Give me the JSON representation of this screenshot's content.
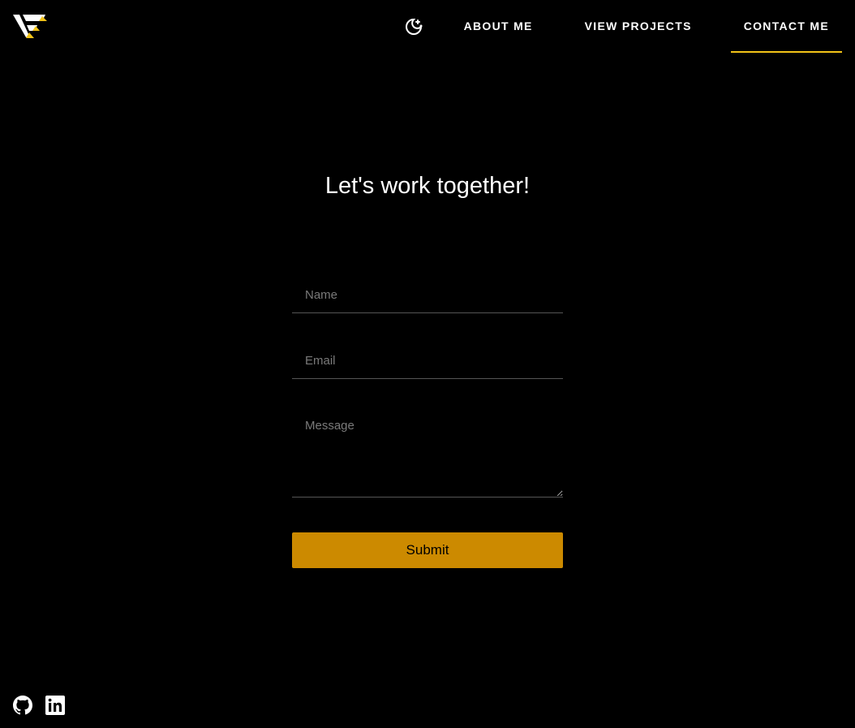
{
  "header": {
    "logo_icon": "vf-logo",
    "theme_toggle_icon": "moon-stars-icon",
    "nav": [
      {
        "label": "ABOUT ME",
        "active": false
      },
      {
        "label": "VIEW PROJECTS",
        "active": false
      },
      {
        "label": "CONTACT ME",
        "active": true
      }
    ],
    "accent_color": "#f2c318"
  },
  "main": {
    "title": "Let's work together!",
    "form": {
      "name_placeholder": "Name",
      "name_value": "",
      "email_placeholder": "Email",
      "email_value": "",
      "message_placeholder": "Message",
      "message_value": "",
      "submit_label": "Submit",
      "submit_color": "#cc8a00"
    }
  },
  "footer": {
    "icons": [
      "github-icon",
      "linkedin-icon"
    ]
  }
}
